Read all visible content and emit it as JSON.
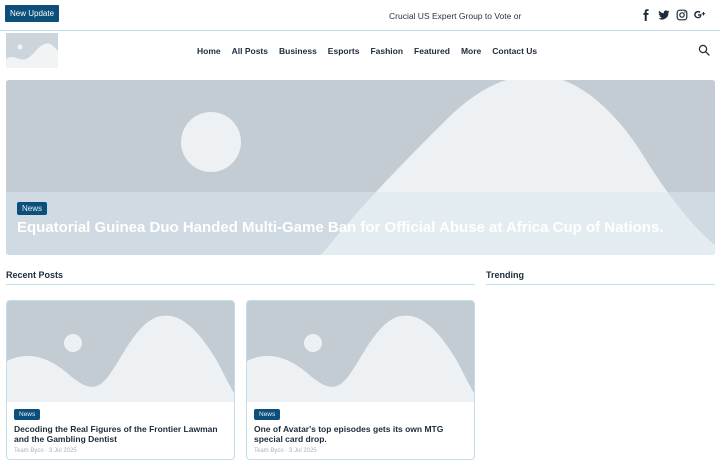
{
  "topbar": {
    "badge_label": "New Update",
    "ticker_text": "Crucial US Expert Group to Vote or",
    "social_icons": [
      "facebook-icon",
      "twitter-icon",
      "instagram-icon",
      "google-plus-icon"
    ]
  },
  "nav": {
    "items": [
      "Home",
      "All Posts",
      "Business",
      "Esports",
      "Fashion",
      "Featured",
      "More",
      "Contact Us"
    ]
  },
  "hero": {
    "tag": "News",
    "title": "Equatorial Guinea Duo Handed Multi-Game Ban for Official Abuse at Africa Cup of Nations."
  },
  "sections": {
    "recent": "Recent Posts",
    "trending": "Trending"
  },
  "cards": [
    {
      "tag": "News",
      "title": "Decoding the Real Figures of the Frontier Lawman and the Gambling Dentist",
      "meta": "Team Byco · 3 Jul 2025"
    },
    {
      "tag": "News",
      "title": "One of Avatar's top episodes gets its own MTG special card drop.",
      "meta": "Team Byco · 3 Jul 2025"
    }
  ],
  "colors": {
    "accent": "#0b4f7a",
    "rule": "#bfe0ea",
    "placeholder_dark": "#c3cbd3",
    "placeholder_light": "#eef1f3"
  }
}
